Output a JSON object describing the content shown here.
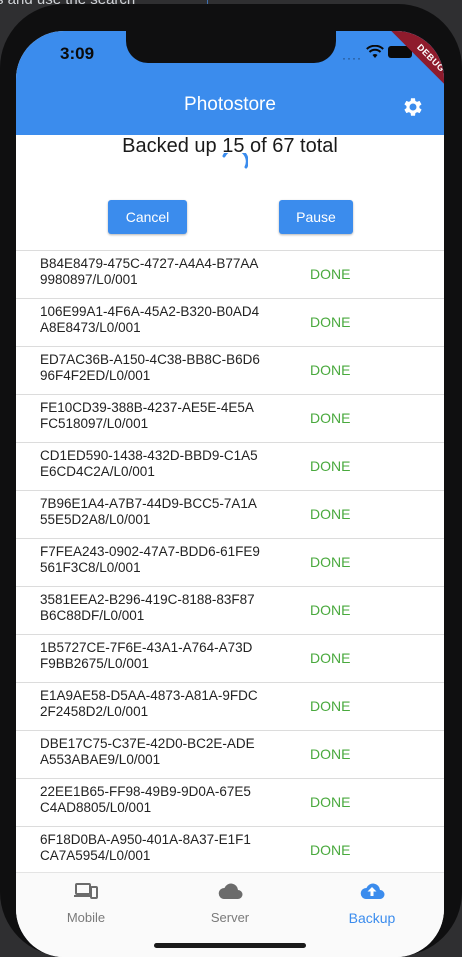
{
  "background": {
    "text": "s and use the search"
  },
  "status_bar": {
    "time": "3:09",
    "debug_banner": "DEBUG"
  },
  "app_bar": {
    "title": "Photostore",
    "settings_icon": "gear-icon"
  },
  "progress": {
    "text": "Backed up 15 of 67 total"
  },
  "buttons": {
    "cancel": "Cancel",
    "pause": "Pause"
  },
  "items": [
    {
      "name": "B84E8479-475C-4727-A4A4-B77AA9980897/L0/001",
      "status": "DONE"
    },
    {
      "name": "106E99A1-4F6A-45A2-B320-B0AD4A8E8473/L0/001",
      "status": "DONE"
    },
    {
      "name": "ED7AC36B-A150-4C38-BB8C-B6D696F4F2ED/L0/001",
      "status": "DONE"
    },
    {
      "name": "FE10CD39-388B-4237-AE5E-4E5AFC518097/L0/001",
      "status": "DONE"
    },
    {
      "name": "CD1ED590-1438-432D-BBD9-C1A5E6CD4C2A/L0/001",
      "status": "DONE"
    },
    {
      "name": "7B96E1A4-A7B7-44D9-BCC5-7A1A55E5D2A8/L0/001",
      "status": "DONE"
    },
    {
      "name": "F7FEA243-0902-47A7-BDD6-61FE9561F3C8/L0/001",
      "status": "DONE"
    },
    {
      "name": "3581EEA2-B296-419C-8188-83F87B6C88DF/L0/001",
      "status": "DONE"
    },
    {
      "name": "1B5727CE-7F6E-43A1-A764-A73DF9BB2675/L0/001",
      "status": "DONE"
    },
    {
      "name": "E1A9AE58-D5AA-4873-A81A-9FDC2F2458D2/L0/001",
      "status": "DONE"
    },
    {
      "name": "DBE17C75-C37E-42D0-BC2E-ADEA553ABAE9/L0/001",
      "status": "DONE"
    },
    {
      "name": "22EE1B65-FF98-49B9-9D0A-67E5C4AD8805/L0/001",
      "status": "DONE"
    },
    {
      "name": "6F18D0BA-A950-401A-8A37-E1F1CA7A5954/L0/001",
      "status": "DONE"
    }
  ],
  "bottom_nav": [
    {
      "label": "Mobile",
      "icon": "mobile-devices-icon"
    },
    {
      "label": "Server",
      "icon": "cloud-icon"
    },
    {
      "label": "Backup",
      "icon": "cloud-upload-icon",
      "active": true
    }
  ],
  "colors": {
    "accent": "#3b8ced",
    "done": "#49a93d"
  }
}
